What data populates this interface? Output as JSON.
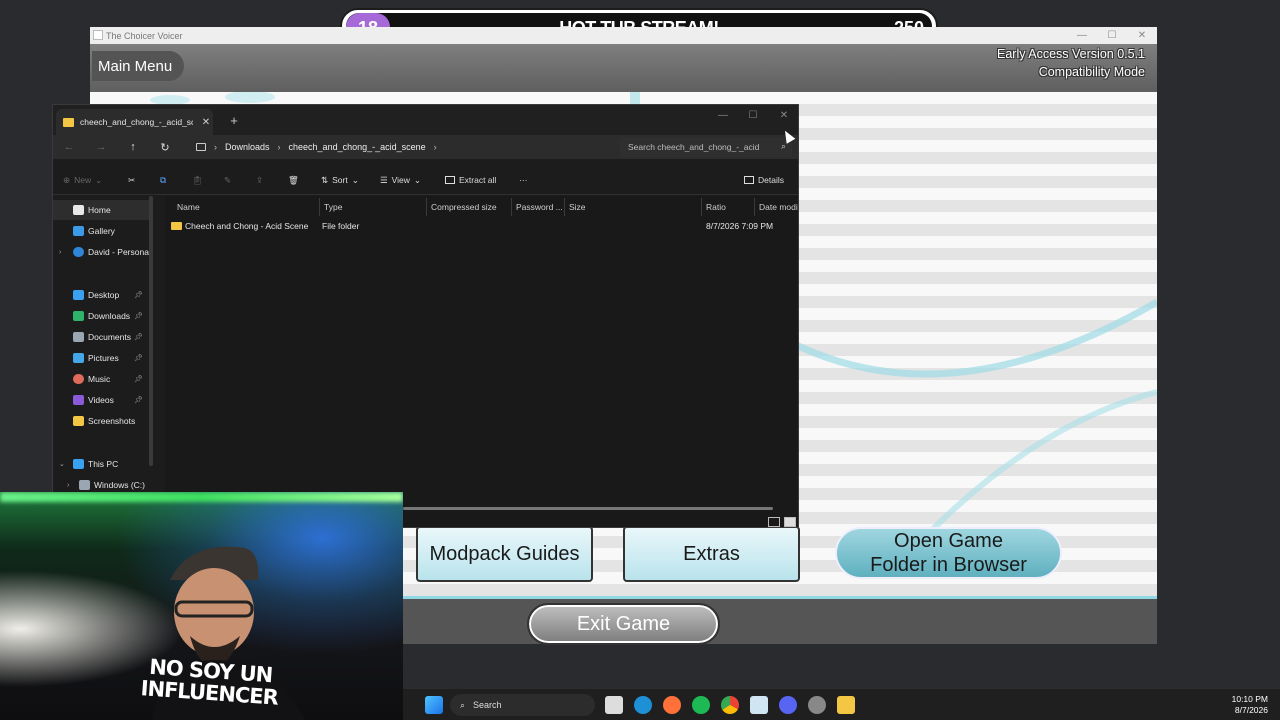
{
  "stream_overlay": {
    "left_count": "18",
    "title": "HOT TUB STREAM!",
    "right_count": "250",
    "pill_color": "#a56ad8"
  },
  "game": {
    "window_title": "The Choicer Voicer",
    "main_menu": "Main Menu",
    "version_line1": "Early Access Version 0.5.1",
    "version_line2": "Compatibility Mode",
    "buttons": {
      "modpack": "Modpack Guides",
      "extras": "Extras",
      "open_folder_line1": "Open Game",
      "open_folder_line2": "Folder in Browser",
      "exit": "Exit Game"
    },
    "accent_color": "#8fd7e2"
  },
  "explorer": {
    "tab_label": "cheech_and_chong_-_acid_sce",
    "breadcrumb": [
      "Downloads",
      "cheech_and_chong_-_acid_scene"
    ],
    "search_placeholder": "Search cheech_and_chong_-_acid",
    "toolbar": {
      "new": "New",
      "sort": "Sort",
      "view": "View",
      "extract_all": "Extract all",
      "more": "···",
      "details": "Details"
    },
    "nav": {
      "home": "Home",
      "gallery": "Gallery",
      "onedrive": "David - Persona",
      "desktop": "Desktop",
      "downloads": "Downloads",
      "documents": "Documents",
      "pictures": "Pictures",
      "music": "Music",
      "videos": "Videos",
      "screenshots": "Screenshots",
      "this_pc": "This PC",
      "windows_c": "Windows (C:)"
    },
    "columns": [
      "Name",
      "Type",
      "Compressed size",
      "Password ...",
      "Size",
      "Ratio",
      "Date modified"
    ],
    "rows": [
      {
        "name": "Cheech and Chong - Acid Scene",
        "type": "File folder",
        "compressed": "",
        "password": "",
        "size": "",
        "ratio": "",
        "date": "8/7/2026 7:09 PM"
      }
    ]
  },
  "webcam": {
    "shirt_line1": "NO SOY UN",
    "shirt_line2": "INFLUENCER"
  },
  "taskbar": {
    "search_label": "Search",
    "time": "10:10 PM",
    "date": "8/7/2026"
  }
}
